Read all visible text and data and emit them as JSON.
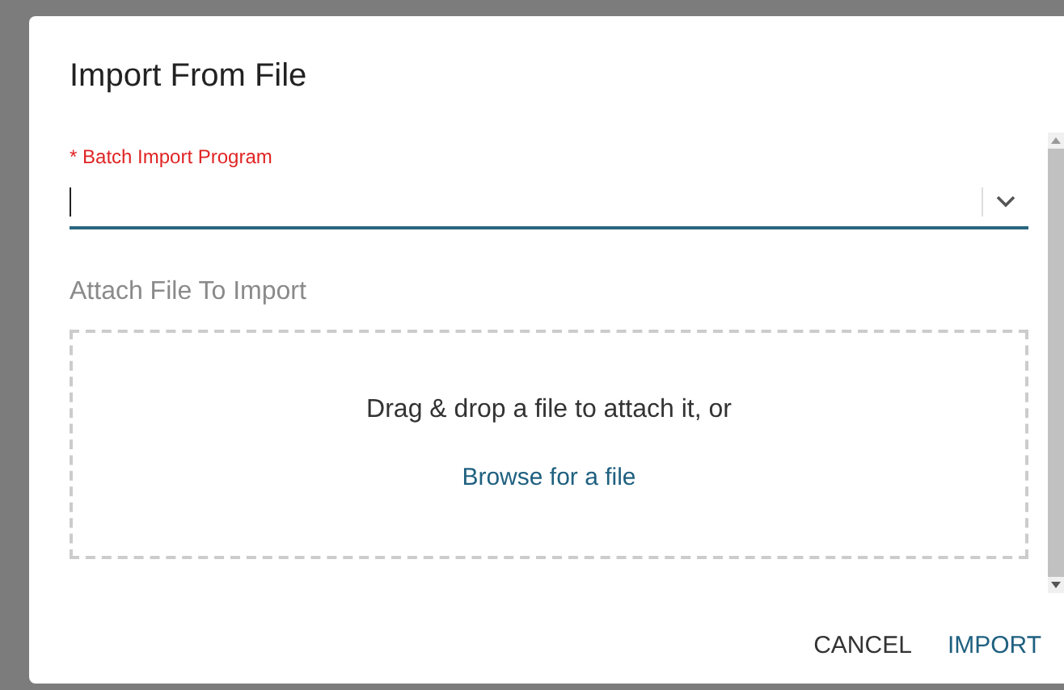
{
  "dialog": {
    "title": "Import From File"
  },
  "program_field": {
    "required_mark": "*",
    "label": "Batch Import Program",
    "focused": true
  },
  "attach": {
    "label": "Attach File To Import",
    "drop_text": "Drag & drop a file to attach it, or",
    "browse_link": "Browse for a file"
  },
  "buttons": [
    {
      "label": "CANCEL",
      "kind": "secondary"
    },
    {
      "label": "IMPORT",
      "kind": "primary"
    }
  ]
}
